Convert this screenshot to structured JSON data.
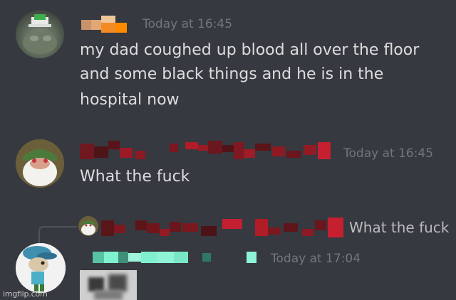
{
  "messages": [
    {
      "timestamp": "Today at 16:45",
      "lines": [
        "my dad coughed up blood all over the floor",
        "and some black things and he is in the",
        "hospital now"
      ]
    },
    {
      "timestamp": "Today at 16:45",
      "lines": [
        "What the fuck"
      ]
    },
    {
      "reply_preview": "What the fuck",
      "timestamp": "Today at 17:04"
    }
  ],
  "colors": {
    "background": "#36393f",
    "text": "#dcddde",
    "timestamp": "#72767d",
    "redacted_red": "#b01c28",
    "redacted_teal": "#7ff1cf"
  },
  "watermark": "imgflip.com"
}
